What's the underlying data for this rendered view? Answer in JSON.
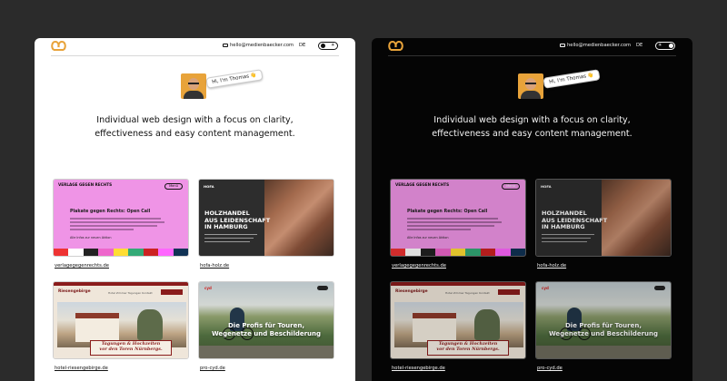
{
  "header": {
    "email": "hello@medienbaecker.com",
    "lang": "DE",
    "toggle_light": "☀",
    "toggle_dark": "☀"
  },
  "intro": {
    "greeting": "Hi, I'm Thomas 👋",
    "tagline_l1": "Individual web design with a focus on clarity,",
    "tagline_l2": "effectiveness and easy content management."
  },
  "projects": [
    {
      "label": "verlagegegenrechts.de",
      "logo": "VERLAGE GEGEN RECHTS",
      "menu": "Menü",
      "title": "Plakate gegen Rechts: Open Call",
      "more": "Alle Infos zur neuen Aktion"
    },
    {
      "label": "hofa-holz.de",
      "logo": "HOFA",
      "headline_l1": "HOLZHANDEL",
      "headline_l2": "AUS LEIDENSCHAFT",
      "headline_l3": "IN HAMBURG"
    },
    {
      "label": "hotel-riesengebirge.de",
      "name": "Riesengebirge",
      "nav": "Hotel  Zimmer  Tagungen  Kontakt",
      "box_l1": "Tagungen & Hochzeiten",
      "box_l2": "vor den Toren Nürnbergs."
    },
    {
      "label": "pro-cyd.de",
      "logo": "cyd",
      "headline_l1": "Die Profis für Touren,",
      "headline_l2": "Wegenetze und Beschilderung"
    }
  ],
  "colors": {
    "light_bg": "#ffffff",
    "dark_bg": "#050505",
    "accent": "#e8a33a",
    "pink": "#ef94e6"
  }
}
